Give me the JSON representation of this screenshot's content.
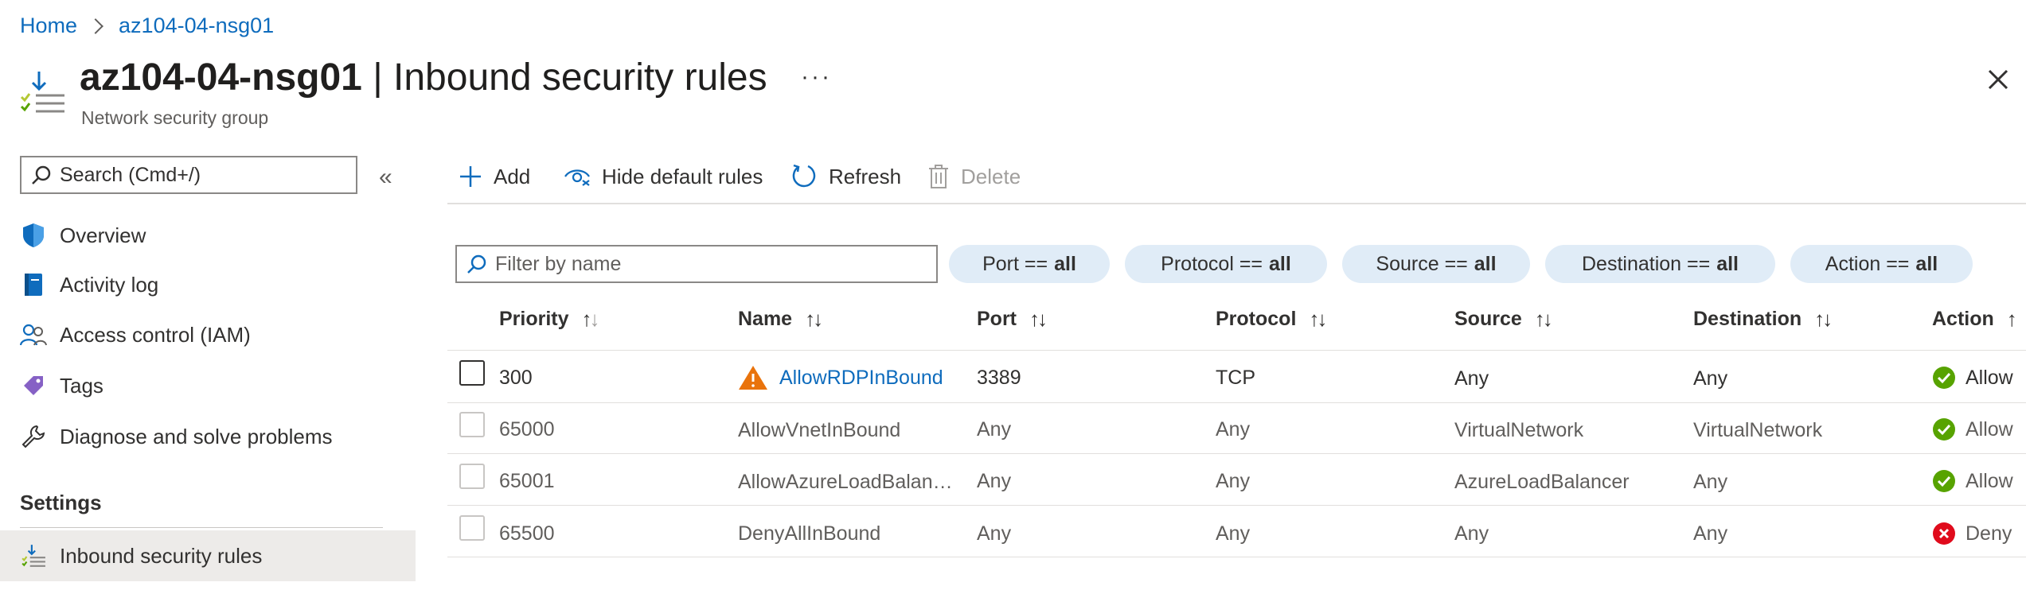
{
  "breadcrumb": {
    "home": "Home",
    "current": "az104-04-nsg01"
  },
  "header": {
    "resource_name": "az104-04-nsg01",
    "separator": " | ",
    "page_name": "Inbound security rules",
    "subtitle": "Network security group",
    "more": "···"
  },
  "sidebar": {
    "search_placeholder": "Search (Cmd+/)",
    "items": [
      {
        "label": "Overview",
        "icon": "shield-icon"
      },
      {
        "label": "Activity log",
        "icon": "activity-log-icon"
      },
      {
        "label": "Access control (IAM)",
        "icon": "people-icon"
      },
      {
        "label": "Tags",
        "icon": "tag-icon"
      },
      {
        "label": "Diagnose and solve problems",
        "icon": "wrench-icon"
      }
    ],
    "settings_heading": "Settings",
    "active_item": {
      "label": "Inbound security rules",
      "icon": "inbound-rules-icon"
    }
  },
  "toolbar": {
    "add": "Add",
    "hide_default": "Hide default rules",
    "refresh": "Refresh",
    "delete": "Delete"
  },
  "filters": {
    "name_placeholder": "Filter by name",
    "pills": [
      {
        "key": "Port ==",
        "value": "all"
      },
      {
        "key": "Protocol ==",
        "value": "all"
      },
      {
        "key": "Source ==",
        "value": "all"
      },
      {
        "key": "Destination ==",
        "value": "all"
      },
      {
        "key": "Action ==",
        "value": "all"
      }
    ]
  },
  "table": {
    "columns": [
      "Priority",
      "Name",
      "Port",
      "Protocol",
      "Source",
      "Destination",
      "Action"
    ],
    "rows": [
      {
        "priority": "300",
        "name": "AllowRDPInBound",
        "port": "3389",
        "protocol": "TCP",
        "source": "Any",
        "destination": "Any",
        "action": "Allow",
        "warning": true
      },
      {
        "priority": "65000",
        "name": "AllowVnetInBound",
        "port": "Any",
        "protocol": "Any",
        "source": "VirtualNetwork",
        "destination": "VirtualNetwork",
        "action": "Allow",
        "warning": false
      },
      {
        "priority": "65001",
        "name": "AllowAzureLoadBalan…",
        "port": "Any",
        "protocol": "Any",
        "source": "AzureLoadBalancer",
        "destination": "Any",
        "action": "Allow",
        "warning": false
      },
      {
        "priority": "65500",
        "name": "DenyAllInBound",
        "port": "Any",
        "protocol": "Any",
        "source": "Any",
        "destination": "Any",
        "action": "Deny",
        "warning": false
      }
    ]
  },
  "colors": {
    "link": "#0f6cbd",
    "allow": "#57a300",
    "deny": "#e00b1c",
    "warning": "#e9730c",
    "pill_bg": "#e0ecf7"
  }
}
